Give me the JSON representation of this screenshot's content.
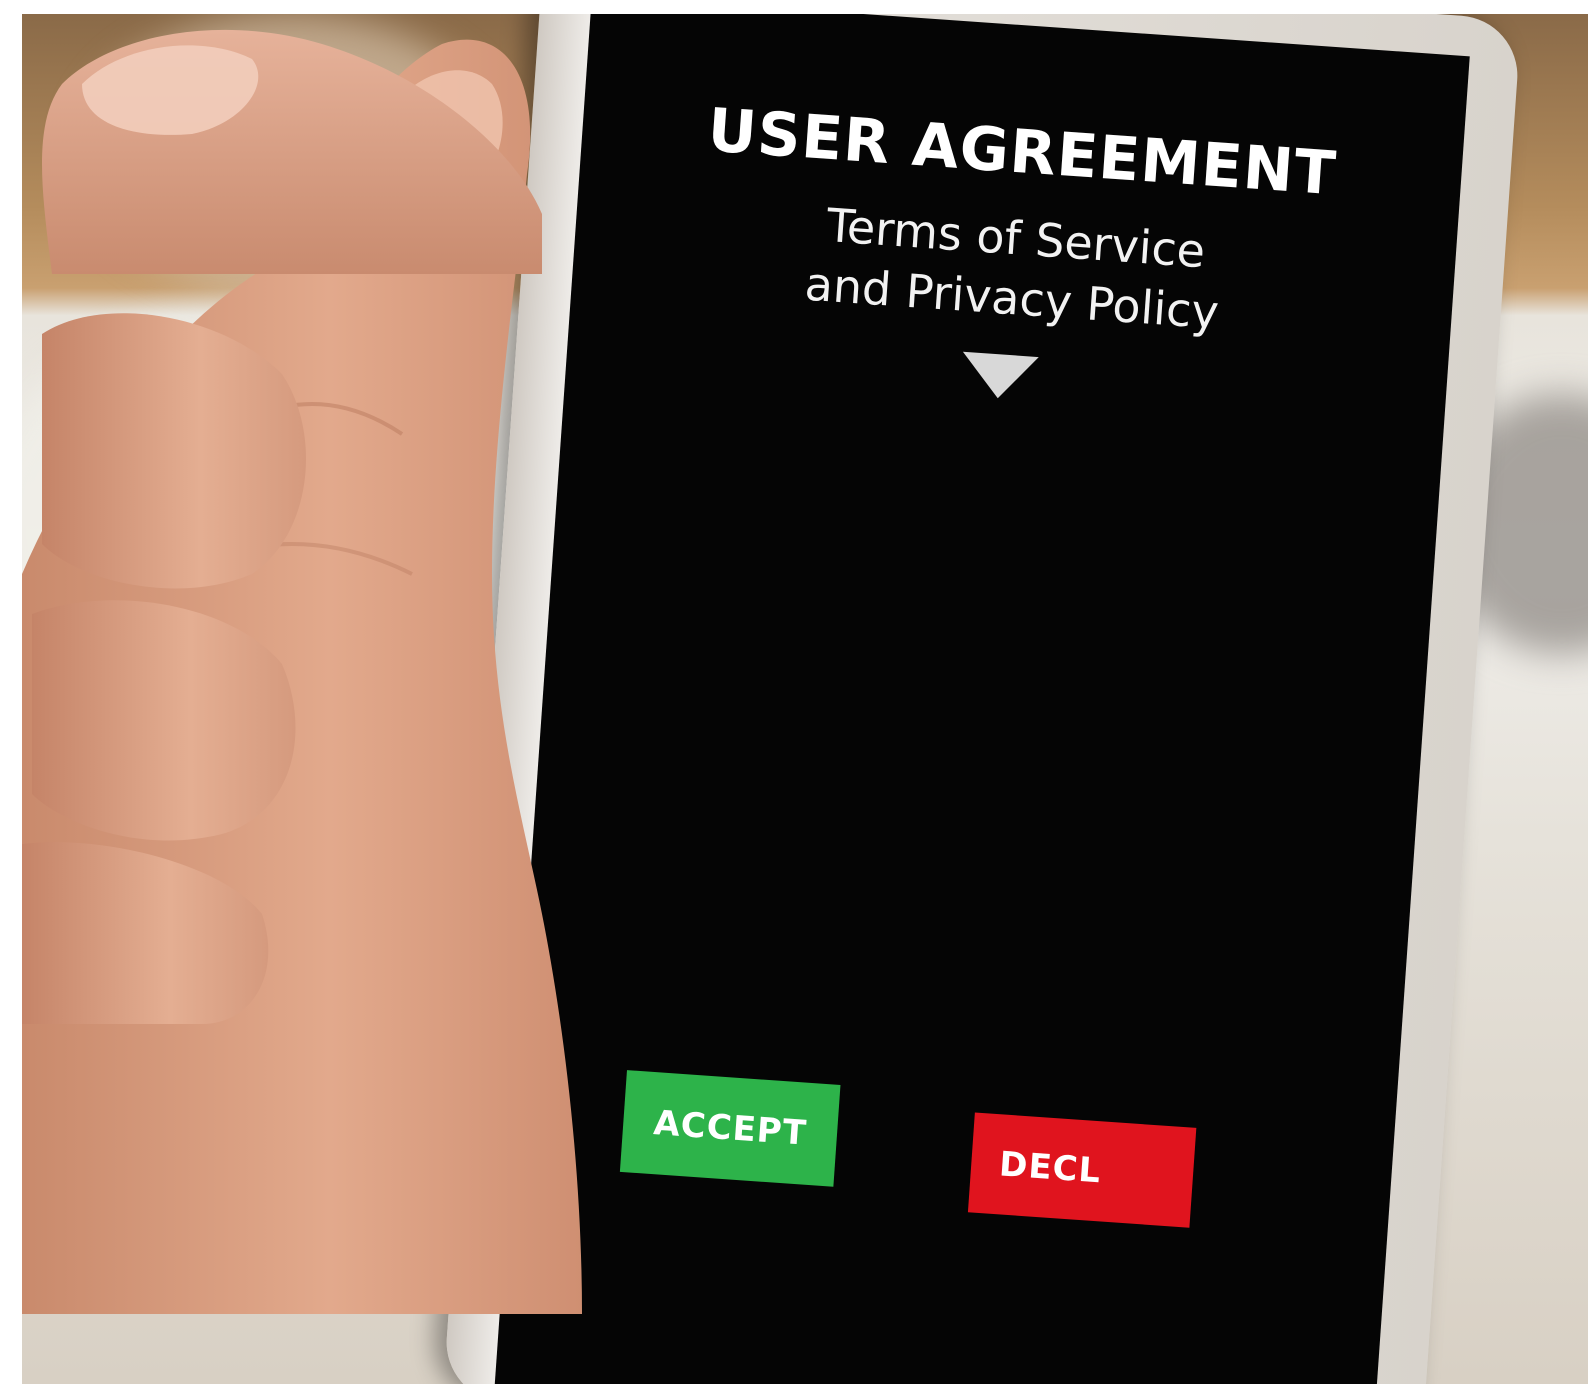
{
  "screen": {
    "title": "USER AGREEMENT",
    "subtitle_line1": "Terms of Service",
    "subtitle_line2": "and Privacy Policy",
    "scroll_indicator_icon": "triangle-down-icon"
  },
  "buttons": {
    "accept_label": "ACCEPT",
    "decline_label": "DECL",
    "accept_color": "#2db34a",
    "decline_color": "#e0141e"
  },
  "colors": {
    "screen_background": "#050505",
    "text": "#ffffff",
    "skin": "#e0a588"
  }
}
